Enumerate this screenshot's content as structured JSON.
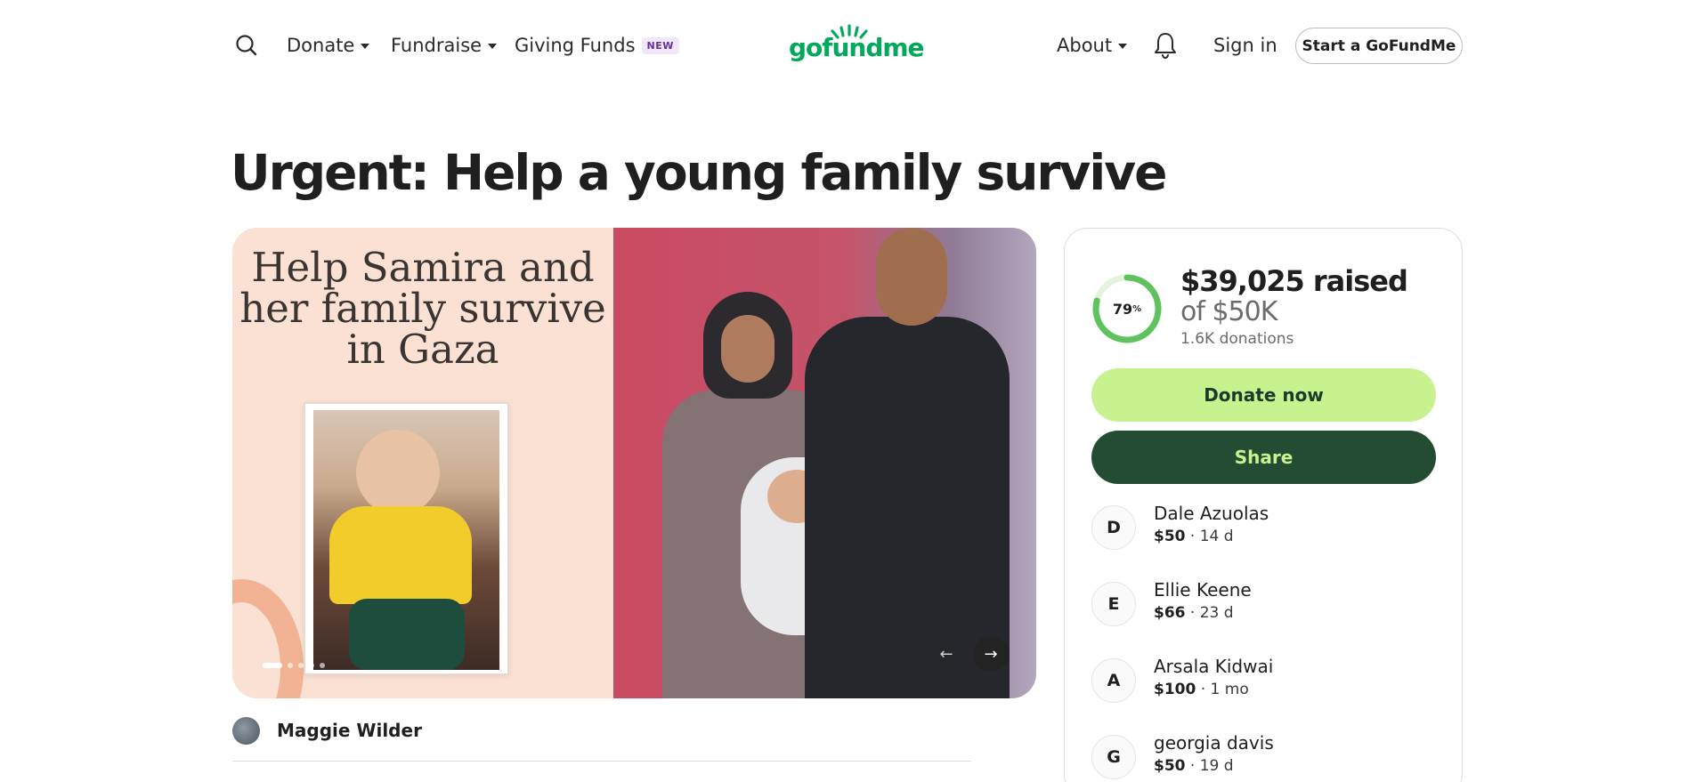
{
  "header": {
    "nav": {
      "donate": "Donate",
      "fundraise": "Fundraise",
      "giving_funds": "Giving Funds",
      "giving_funds_badge": "NEW",
      "about": "About"
    },
    "logo_text": "gofundme",
    "sign_in": "Sign in",
    "start_button": "Start a GoFundMe"
  },
  "campaign": {
    "title": "Urgent: Help a young family survive",
    "hero_caption": "Help Samira and her family survive in Gaza",
    "carousel": {
      "slide_count": 5,
      "active_index": 0
    },
    "organizer": "Maggie Wilder"
  },
  "progress": {
    "percent": 79,
    "percent_label": "79",
    "percent_suffix": "%",
    "raised": "$39,025 raised",
    "goal": "of $50K",
    "donations": "1.6K donations"
  },
  "actions": {
    "donate": "Donate now",
    "share": "Share"
  },
  "donors": [
    {
      "initial": "D",
      "name": "Dale Azuolas",
      "amount": "$50",
      "time": "· 14 d"
    },
    {
      "initial": "E",
      "name": "Ellie Keene",
      "amount": "$66",
      "time": "· 23 d"
    },
    {
      "initial": "A",
      "name": "Arsala Kidwai",
      "amount": "$100",
      "time": "· 1 mo"
    },
    {
      "initial": "G",
      "name": "georgia davis",
      "amount": "$50",
      "time": "· 19 d"
    }
  ],
  "colors": {
    "brand_green": "#02a95c",
    "donate_button": "#c8f28f",
    "share_button": "#234c33",
    "progress_ring": "#5ec35e"
  },
  "icons": {
    "search": "search-icon",
    "bell": "bell-icon",
    "prev": "arrow-left-icon",
    "next": "arrow-right-icon"
  }
}
